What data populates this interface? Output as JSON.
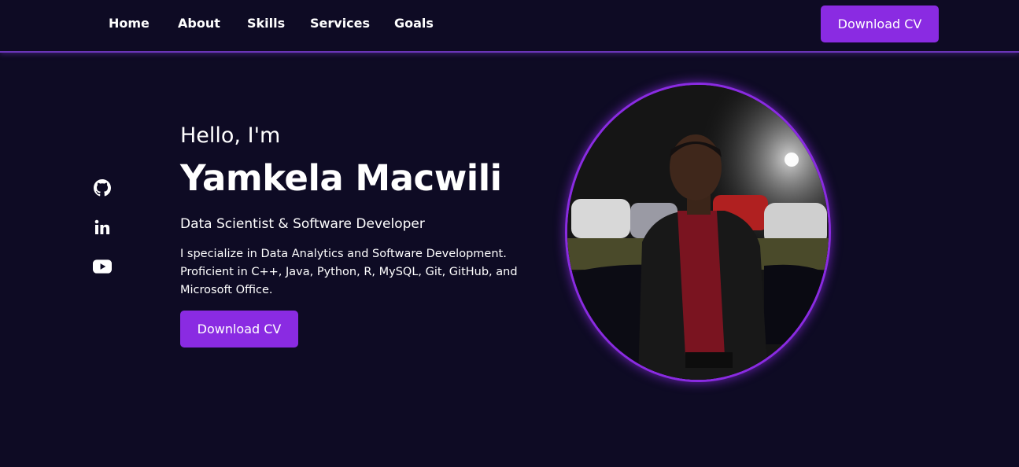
{
  "nav": {
    "links": [
      "Home",
      "About",
      "Skills",
      "Services",
      "Goals"
    ],
    "cta_label": "Download CV"
  },
  "social": [
    {
      "icon": "github-icon"
    },
    {
      "icon": "linkedin-icon"
    },
    {
      "icon": "youtube-icon"
    }
  ],
  "hero": {
    "greeting": "Hello, I'm",
    "name": "Yamkela Macwili",
    "role": "Data Scientist & Software Developer",
    "bio": "I specialize in Data Analytics and Software Development. Proficient in C++, Java, Python, R, MySQL, Git, GitHub, and Microsoft Office.",
    "cta_label": "Download CV",
    "photo": "profile-photo"
  },
  "colors": {
    "background": "#0e0b24",
    "accent": "#8a2be2",
    "text": "#ffffff"
  }
}
